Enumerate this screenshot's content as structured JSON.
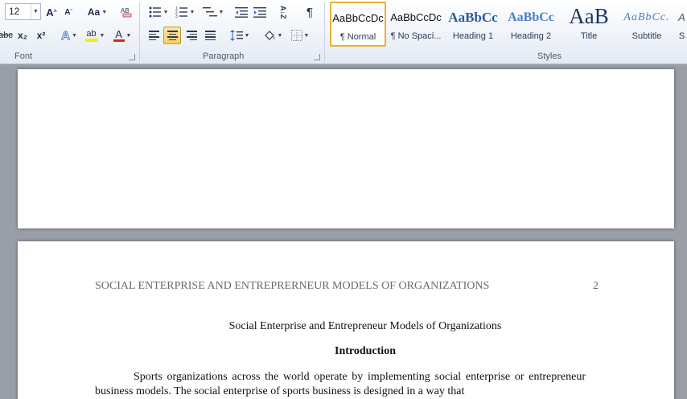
{
  "font": {
    "size_value": "12",
    "group_label": "Font",
    "grow_font": "A",
    "shrink_font": "A",
    "change_case": "Aa",
    "strike": "abc",
    "subscript": "x₂",
    "superscript": "x²",
    "text_effects": "A",
    "highlight": "ab",
    "font_color": "A"
  },
  "paragraph": {
    "group_label": "Paragraph",
    "sort": "A↓Z",
    "pilcrow": "¶"
  },
  "styles": {
    "group_label": "Styles",
    "items": [
      {
        "sample": "AaBbCcDc",
        "name": "¶ Normal"
      },
      {
        "sample": "AaBbCcDc",
        "name": "¶ No Spaci..."
      },
      {
        "sample": "AaBbCc",
        "name": "Heading 1"
      },
      {
        "sample": "AaBbCc",
        "name": "Heading 2"
      },
      {
        "sample": "AaB",
        "name": "Title"
      },
      {
        "sample": "AaBbCc.",
        "name": "Subtitle"
      },
      {
        "sample": "A",
        "name": "S"
      }
    ]
  },
  "document": {
    "running_head": "SOCIAL ENTERPRISE AND ENTREPRERNEUR MODELS OF ORGANIZATIONS",
    "page_number": "2",
    "title": "Social Enterprise and Entrepreneur Models of Organizations",
    "heading": "Introduction",
    "body_line1": "Sports organizations across the world operate by implementing social enterprise or",
    "body_line2": "entrepreneur business models. The social enterprise of sports business is designed in a way that"
  },
  "colors": {
    "highlight": "#f5f000",
    "font_color": "#e02020",
    "selected_style_border": "#e6b32c",
    "heading_blue": "#2b5b96"
  }
}
